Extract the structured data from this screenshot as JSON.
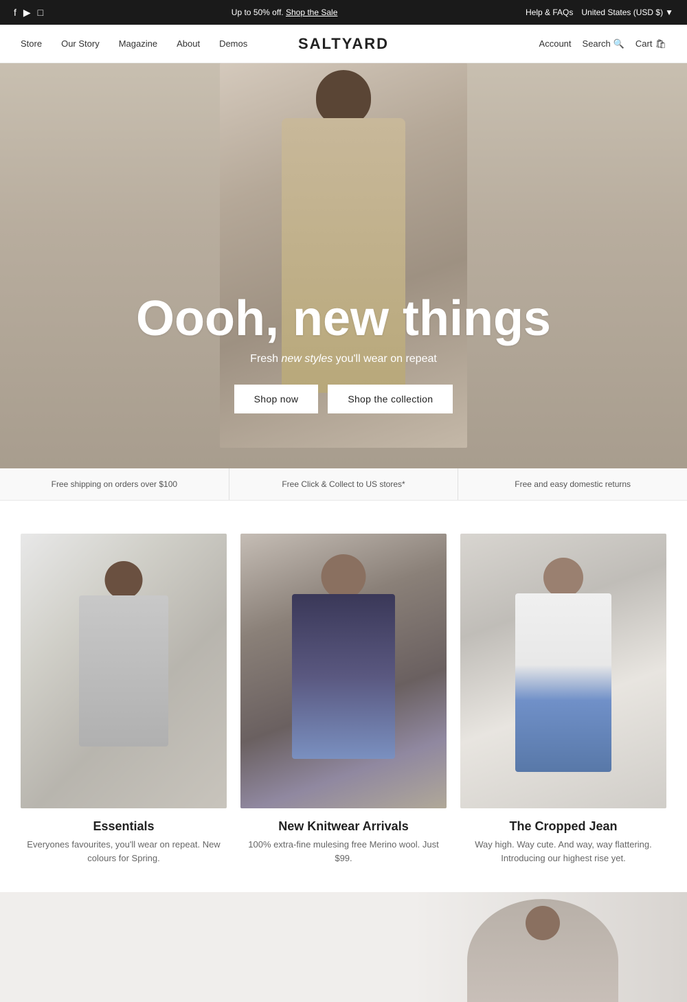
{
  "topbar": {
    "promo_text": "Up to 50% off. ",
    "promo_link": "Shop the Sale",
    "help": "Help & FAQs",
    "region": "United States (USD $)",
    "social": [
      "f",
      "▶",
      "◻"
    ]
  },
  "nav": {
    "brand": "SALTYARD",
    "links": [
      "Store",
      "Our Story",
      "Magazine",
      "About",
      "Demos"
    ],
    "account": "Account",
    "search": "Search",
    "cart": "Cart"
  },
  "hero": {
    "title": "Oooh, new things",
    "subtitle_plain": "Fresh ",
    "subtitle_italic": "new styles",
    "subtitle_end": " you'll wear on repeat",
    "btn_shop_now": "Shop now",
    "btn_shop_collection": "Shop the collection"
  },
  "infobar": {
    "items": [
      "Free shipping on orders over $100",
      "Free Click & Collect to US stores*",
      "Free and easy domestic returns"
    ]
  },
  "products": [
    {
      "title": "Essentials",
      "desc": "Everyones favourites, you'll wear on repeat.\nNew colours for Spring."
    },
    {
      "title": "New Knitwear Arrivals",
      "desc": "100% extra-fine mulesing free Merino wool.\nJust $99."
    },
    {
      "title": "The Cropped Jean",
      "desc": "Way high. Way cute. And way, way flattering.\nIntroducing our highest rise yet."
    }
  ]
}
